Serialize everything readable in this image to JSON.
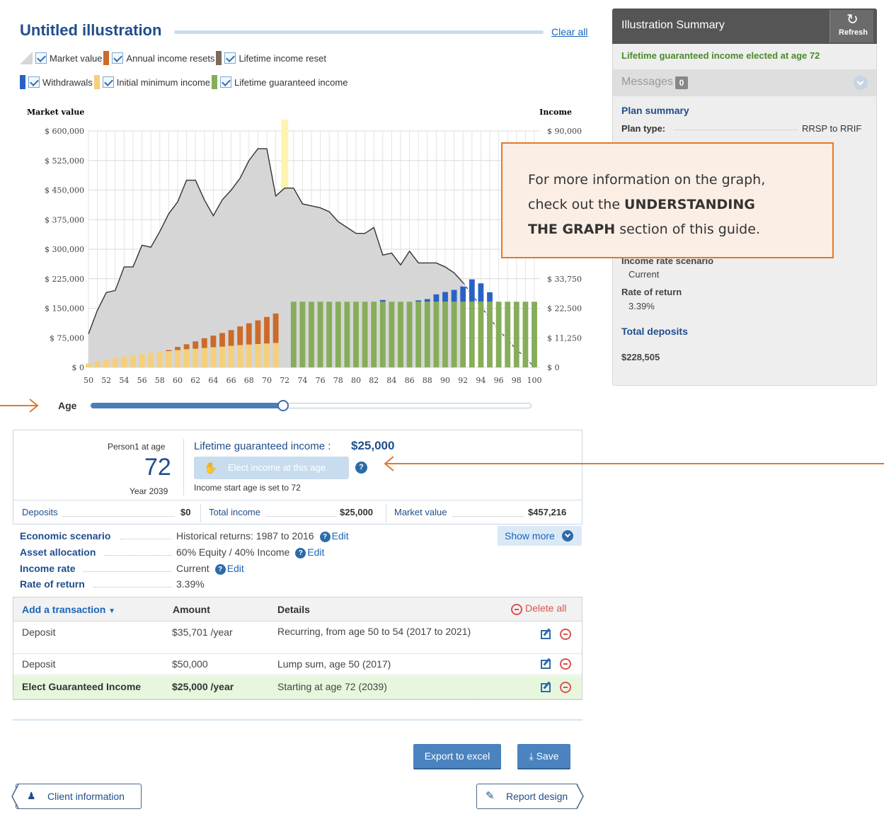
{
  "header": {
    "title": "Untitled illustration",
    "clear_all": "Clear all"
  },
  "legend": {
    "row1": [
      "Market value",
      "Annual income resets",
      "Lifetime income reset"
    ],
    "row2": [
      "Withdrawals",
      "Initial minimum income",
      "Lifetime guaranteed income"
    ],
    "colors": {
      "market_value": "#d6d6d6",
      "annual_income_resets": "#cc6a2a",
      "lifetime_income_reset": "#7a6a5a",
      "withdrawals": "#2a62c4",
      "initial_minimum_income": "#f5cf7a",
      "lifetime_guaranteed_income": "#86ad5a",
      "elect_marker": "#fff3b0"
    }
  },
  "chart_data": {
    "type": "area",
    "left_axis_label": "Market value",
    "right_axis_label": "Income",
    "x_label": "Age",
    "left_ticks": [
      "$ 600,000",
      "$ 525,000",
      "$ 450,000",
      "$ 375,000",
      "$ 300,000",
      "$ 225,000",
      "$ 150,000",
      "$ 75,000",
      "$ 0"
    ],
    "right_ticks": [
      "$ 90,000",
      "$ 33,750",
      "$ 22,500",
      "$ 11,250",
      "$ 0"
    ],
    "right_tick_values": [
      90000,
      33750,
      22500,
      11250,
      0
    ],
    "ylim_left": [
      0,
      600000
    ],
    "ylim_right": [
      0,
      90000
    ],
    "x_ticks": [
      "50",
      "52",
      "54",
      "56",
      "58",
      "60",
      "62",
      "64",
      "66",
      "68",
      "70",
      "72",
      "74",
      "76",
      "78",
      "80",
      "82",
      "84",
      "86",
      "88",
      "90",
      "92",
      "94",
      "96",
      "98",
      "100"
    ],
    "x": [
      50,
      51,
      52,
      53,
      54,
      55,
      56,
      57,
      58,
      59,
      60,
      61,
      62,
      63,
      64,
      65,
      66,
      67,
      68,
      69,
      70,
      71,
      72,
      73,
      74,
      75,
      76,
      77,
      78,
      79,
      80,
      81,
      82,
      83,
      84,
      85,
      86,
      87,
      88,
      89,
      90,
      91,
      92,
      93,
      94,
      95,
      96,
      97,
      98,
      99,
      100
    ],
    "market_value": [
      85000,
      145000,
      190000,
      195000,
      255000,
      255000,
      310000,
      305000,
      345000,
      390000,
      420000,
      475000,
      475000,
      425000,
      385000,
      425000,
      450000,
      480000,
      525000,
      555000,
      555000,
      435000,
      455000,
      455000,
      415000,
      410000,
      405000,
      395000,
      370000,
      355000,
      340000,
      340000,
      355000,
      285000,
      290000,
      260000,
      295000,
      265000,
      265000,
      265000,
      255000,
      240000,
      215000,
      185000,
      155000,
      125000,
      95000,
      70000,
      45000,
      25000,
      0
    ],
    "market_value_dashed_from_age": 92,
    "initial_minimum_income": [
      1400,
      2200,
      3000,
      3700,
      4200,
      4700,
      5100,
      5500,
      5900,
      6200,
      6600,
      6900,
      7100,
      7400,
      7700,
      7900,
      8200,
      8500,
      8700,
      8900,
      9100,
      9300
    ],
    "annual_income_resets": [
      0,
      0,
      0,
      0,
      0,
      0,
      0,
      0,
      0,
      400,
      1200,
      1900,
      2800,
      3700,
      4400,
      5200,
      6000,
      7100,
      8100,
      9000,
      10100,
      11200
    ],
    "lifetime_guaranteed_income_from_age": 72,
    "lifetime_guaranteed_income": 25000,
    "withdrawals": {
      "83": 25650,
      "87": 25500,
      "88": 26000,
      "89": 27800,
      "90": 28700,
      "91": 29500,
      "92": 30800,
      "93": 33500,
      "94": 32000,
      "95": 28600
    },
    "elect_age_marker": 72,
    "grid": true
  },
  "slider": {
    "label": "Age",
    "min": 50,
    "max": 100,
    "value": 72
  },
  "summary": {
    "title": "Illustration Summary",
    "refresh_label": "Refresh",
    "refresh_icon": "refresh-icon",
    "lifetime_elected": "Lifetime guaranteed income elected at age 72",
    "messages_label": "Messages",
    "messages_count": "0",
    "plan_summary": "Plan summary",
    "plan_type_label": "Plan type:",
    "plan_type_value": "RRSP to RRIF",
    "income_rate_label": "Income rate scenario",
    "income_rate_value": "Current",
    "ror_label": "Rate of return",
    "ror_value": "3.39%",
    "total_deposits_label": "Total deposits",
    "total_deposits_value": "$228,505"
  },
  "callout": {
    "line1": "For more information on the graph,",
    "line2_pre": "check out the ",
    "line2_bold": "UNDERSTANDING",
    "line3_bold": "THE GRAPH",
    "line3_post": " section of this guide."
  },
  "details": {
    "person_label": "Person1  at age",
    "age": "72",
    "year": "Year 2039",
    "lgi_label": "Lifetime guaranteed income :",
    "lgi_value": "$25,000",
    "elect_button": "Elect income at this age",
    "income_start": "Income start age is set to 72",
    "deposits_label": "Deposits",
    "deposits_value": "$0",
    "total_income_label": "Total income",
    "total_income_value": "$25,000",
    "market_value_label": "Market value",
    "market_value_value": "$457,216"
  },
  "scenario": {
    "economic_label": "Economic scenario",
    "economic_value": "Historical returns: 1987 to 2016",
    "asset_label": "Asset allocation",
    "asset_value": "60% Equity / 40% Income",
    "income_rate_label": "Income rate",
    "income_rate_value": "Current",
    "ror_label": "Rate of return",
    "ror_value": "3.39%",
    "edit": "Edit",
    "show_more": "Show more"
  },
  "transactions": {
    "add_label": "Add a transaction",
    "col_amount": "Amount",
    "col_details": "Details",
    "delete_all": "Delete all",
    "rows": [
      {
        "type": "Deposit",
        "amount": "$35,701 /year",
        "details": "Recurring, from age 50 to 54 (2017 to 2021)"
      },
      {
        "type": "Deposit",
        "amount": "$50,000",
        "details": "Lump sum, age 50 (2017)"
      },
      {
        "type": "Elect Guaranteed Income",
        "amount": "$25,000 /year",
        "details": "Starting at age 72 (2039)"
      }
    ]
  },
  "footer": {
    "export": "Export to excel",
    "save": "Save",
    "client_info": "Client information",
    "report_design": "Report design"
  }
}
